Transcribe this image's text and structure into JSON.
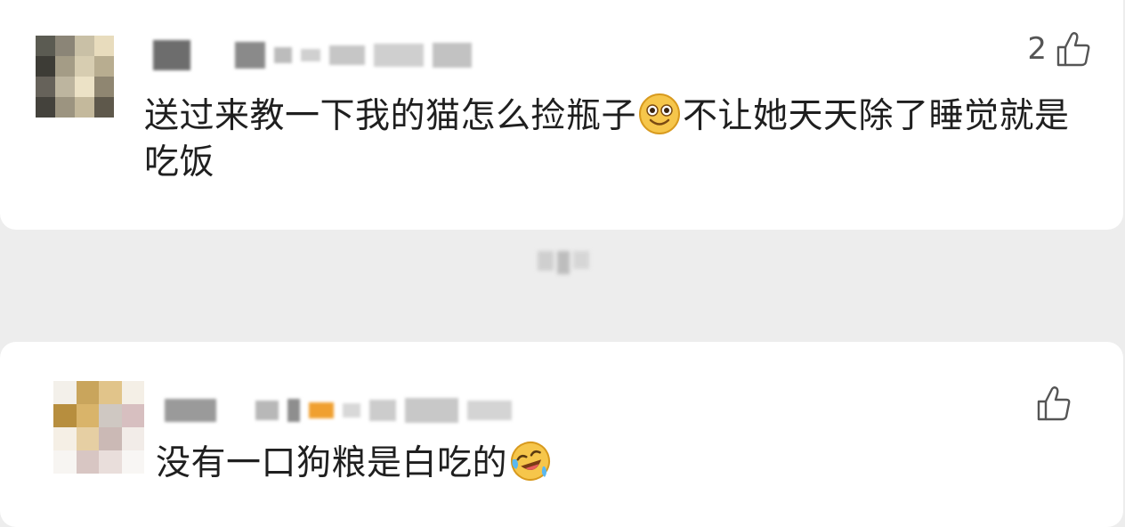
{
  "comments": [
    {
      "text_part1": "送过来教一下我的猫怎么捡瓶子",
      "emoji": "smile-emoji",
      "text_part2": "不让她天天除了睡觉就是吃饭",
      "like_count": "2",
      "like_icon": "thumbs-up-icon"
    },
    {
      "text_part1": "没有一口狗粮是白吃的",
      "emoji": "laugh-cry-emoji",
      "like_count": "",
      "like_icon": "thumbs-up-icon"
    }
  ],
  "colors": {
    "background": "#ededed",
    "card": "#ffffff",
    "text": "#1f1f1f",
    "icon": "#555555",
    "emoji_yellow": "#f6c64b"
  }
}
